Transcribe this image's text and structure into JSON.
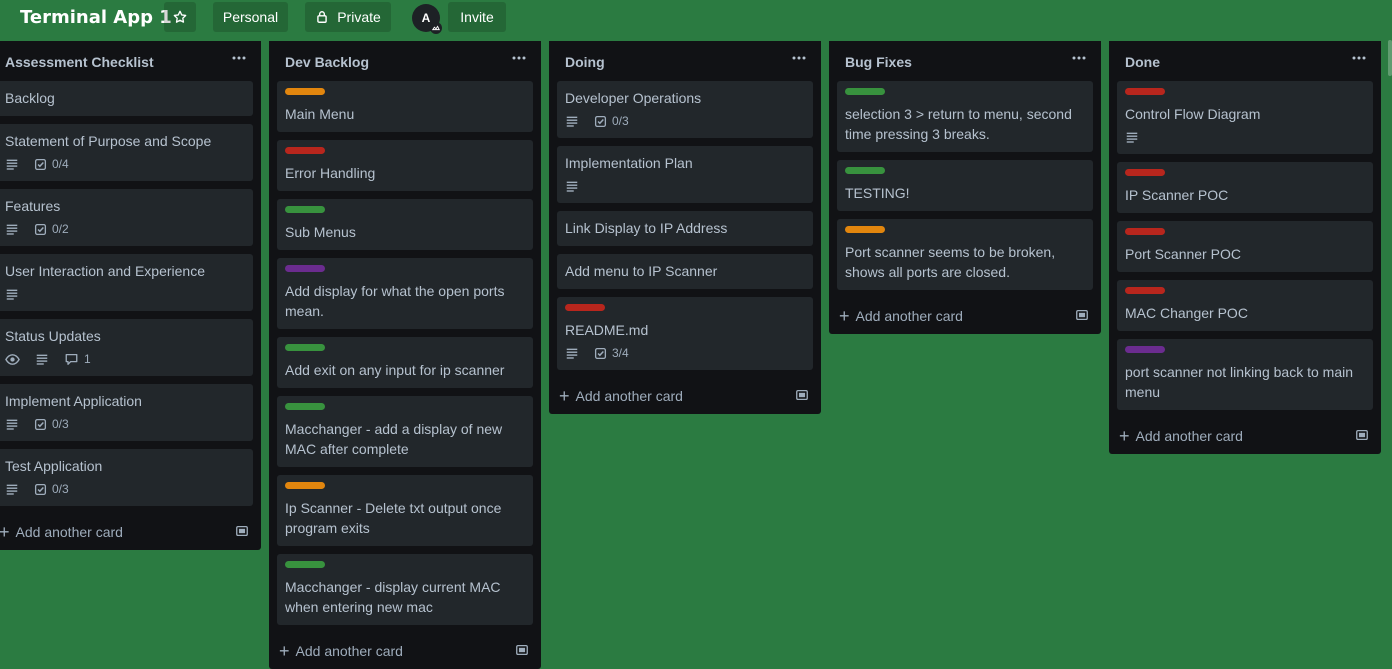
{
  "header": {
    "board_title": "Terminal App 1",
    "personal_label": "Personal",
    "private_label": "Private",
    "avatar_initial": "A",
    "invite_label": "Invite"
  },
  "colors": {
    "background": "#2b7b41",
    "list_bg": "#111215",
    "card_bg": "#22272b",
    "label_orange": "#e2860e",
    "label_red": "#b8261d",
    "label_green": "#38923e",
    "label_purple": "#6b2c8f"
  },
  "add_card_label": "Add another card",
  "lists": [
    {
      "title": "Assessment Checklist",
      "cards": [
        {
          "title": "Backlog"
        },
        {
          "title": "Statement of Purpose and Scope",
          "description": true,
          "checklist": "0/4"
        },
        {
          "title": "Features",
          "description": true,
          "checklist": "0/2"
        },
        {
          "title": "User Interaction and Experience",
          "description": true
        },
        {
          "title": "Status Updates",
          "watching": true,
          "description": true,
          "comments": "1"
        },
        {
          "title": "Implement Application",
          "description": true,
          "checklist": "0/3"
        },
        {
          "title": "Test Application",
          "description": true,
          "checklist": "0/3"
        }
      ]
    },
    {
      "title": "Dev Backlog",
      "cards": [
        {
          "label": "orange",
          "title": "Main Menu"
        },
        {
          "label": "red",
          "title": "Error Handling"
        },
        {
          "label": "green",
          "title": "Sub Menus"
        },
        {
          "label": "purple",
          "title": "Add display for what the open ports mean."
        },
        {
          "label": "green",
          "title": "Add exit on any input for ip scanner"
        },
        {
          "label": "green",
          "title": "Macchanger - add a display of new MAC after complete"
        },
        {
          "label": "orange",
          "title": "Ip Scanner - Delete txt output once program exits"
        },
        {
          "label": "green",
          "title": "Macchanger - display current MAC when entering new mac"
        }
      ]
    },
    {
      "title": "Doing",
      "cards": [
        {
          "title": "Developer Operations",
          "description": true,
          "checklist": "0/3"
        },
        {
          "title": "Implementation Plan",
          "description": true
        },
        {
          "title": "Link Display to IP Address"
        },
        {
          "title": "Add menu to IP Scanner"
        },
        {
          "label": "red",
          "title": "README.md",
          "description": true,
          "checklist": "3/4"
        }
      ]
    },
    {
      "title": "Bug Fixes",
      "cards": [
        {
          "label": "green",
          "title": "selection 3 > return to menu, second time pressing 3 breaks."
        },
        {
          "label": "green",
          "title": "TESTING!"
        },
        {
          "label": "orange",
          "title": "Port scanner seems to be broken, shows all ports are closed."
        }
      ]
    },
    {
      "title": "Done",
      "cards": [
        {
          "label": "red",
          "title": "Control Flow Diagram",
          "description": true
        },
        {
          "label": "red",
          "title": "IP Scanner POC"
        },
        {
          "label": "red",
          "title": "Port Scanner POC"
        },
        {
          "label": "red",
          "title": "MAC Changer POC"
        },
        {
          "label": "purple",
          "title": "port scanner not linking back to main menu"
        }
      ]
    }
  ]
}
